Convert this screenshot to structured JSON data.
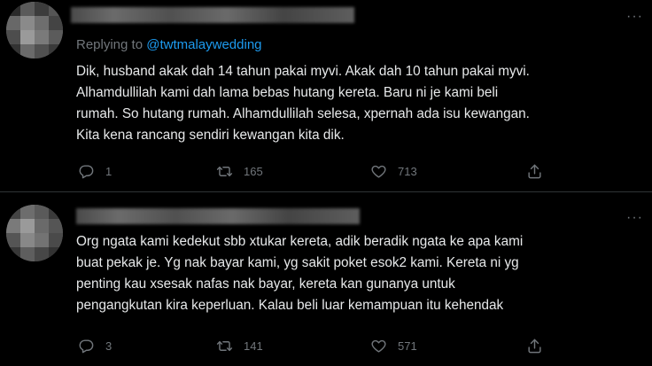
{
  "tweets": [
    {
      "replying_prefix": "Replying to",
      "replying_handle": "@twtmalaywedding",
      "lines": [
        "Dik, husband akak dah 14 tahun pakai myvi. Akak dah 10 tahun pakai myvi.",
        "Alhamdullilah kami dah lama bebas hutang kereta. Baru ni je kami beli",
        "rumah. So hutang rumah. Alhamdullilah selesa, xpernah ada isu kewangan.",
        "Kita kena rancang sendiri kewangan kita dik."
      ],
      "more": "···",
      "replies": "1",
      "retweets": "165",
      "likes": "713"
    },
    {
      "lines": [
        "Org ngata kami kedekut sbb xtukar kereta, adik beradik ngata ke apa kami",
        "buat pekak je. Yg nak bayar kami, yg sakit poket esok2 kami. Kereta ni yg",
        "penting kau xsesak nafas nak bayar, kereta kan gunanya untuk",
        "pengangkutan kira keperluan. Kalau beli luar kemampuan itu kehendak"
      ],
      "more": "···",
      "replies": "3",
      "retweets": "141",
      "likes": "571"
    }
  ],
  "icons": {
    "reply": "reply-icon",
    "retweet": "retweet-icon",
    "like": "heart-icon",
    "share": "share-icon",
    "more": "more-icon"
  },
  "colors": {
    "background": "#000000",
    "text": "#e7e9ea",
    "muted": "#71767b",
    "link": "#1d9bf0",
    "divider": "#2f3336"
  }
}
